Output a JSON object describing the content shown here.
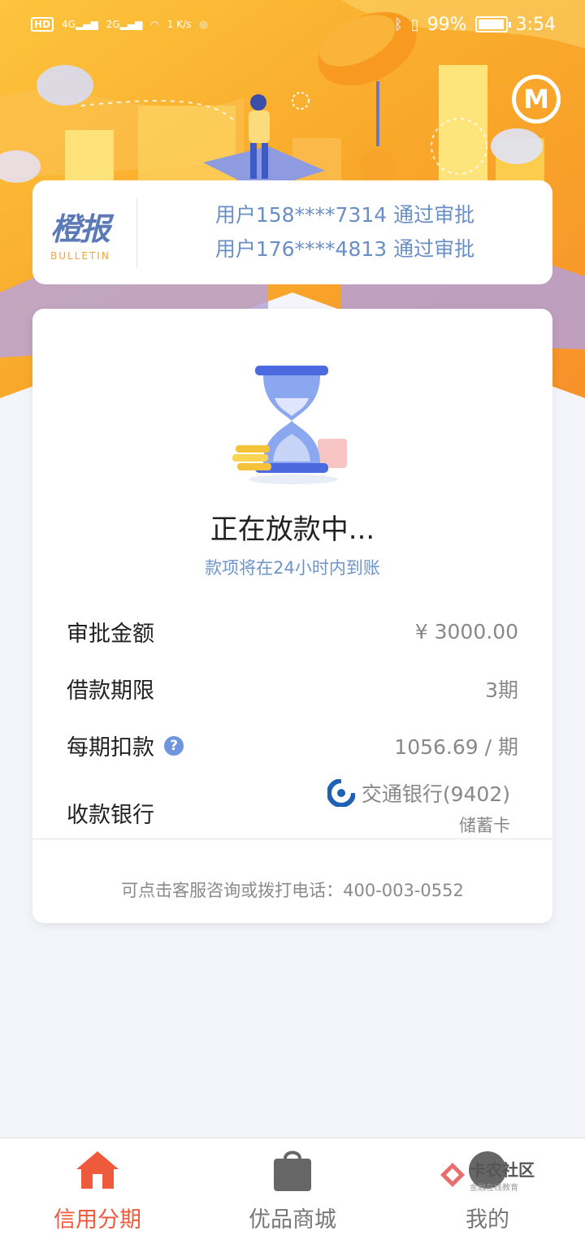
{
  "status_bar": {
    "left_badges": [
      "HD",
      "4G",
      "2G"
    ],
    "speed": "1 K/s",
    "battery": "99%",
    "time": "3:54"
  },
  "header": {
    "logo_icon": "m-circle-logo"
  },
  "bulletin": {
    "logo_cn": "橙报",
    "logo_en": "BULLETIN",
    "items": [
      "用户158****7314 通过审批",
      "用户176****4813 通过审批"
    ]
  },
  "status": {
    "icon": "hourglass-icon",
    "title": "正在放款中...",
    "subtitle": "款项将在24小时内到账"
  },
  "details": {
    "amount_label": "审批金额",
    "amount_value": "¥ 3000.00",
    "term_label": "借款期限",
    "term_value": "3期",
    "installment_label": "每期扣款",
    "installment_value": "1056.69 / 期",
    "bank_label": "收款银行",
    "bank_name": "交通银行(9402)",
    "bank_card_type": "储蓄卡"
  },
  "footer_note": "可点击客服咨询或拨打电话：400-003-0552",
  "bottom_nav": {
    "items": [
      {
        "label": "信用分期",
        "icon": "home-icon",
        "active": true
      },
      {
        "label": "优品商城",
        "icon": "shopping-bag-icon",
        "active": false
      },
      {
        "label": "我的",
        "icon": "user-icon",
        "active": false
      }
    ]
  },
  "watermark": {
    "text": "卡农社区",
    "sub": "金融在线教育"
  },
  "colors": {
    "accent": "#ef5a3c",
    "blue_text": "#6a8fc4",
    "hero_orange": "#f9b233"
  }
}
